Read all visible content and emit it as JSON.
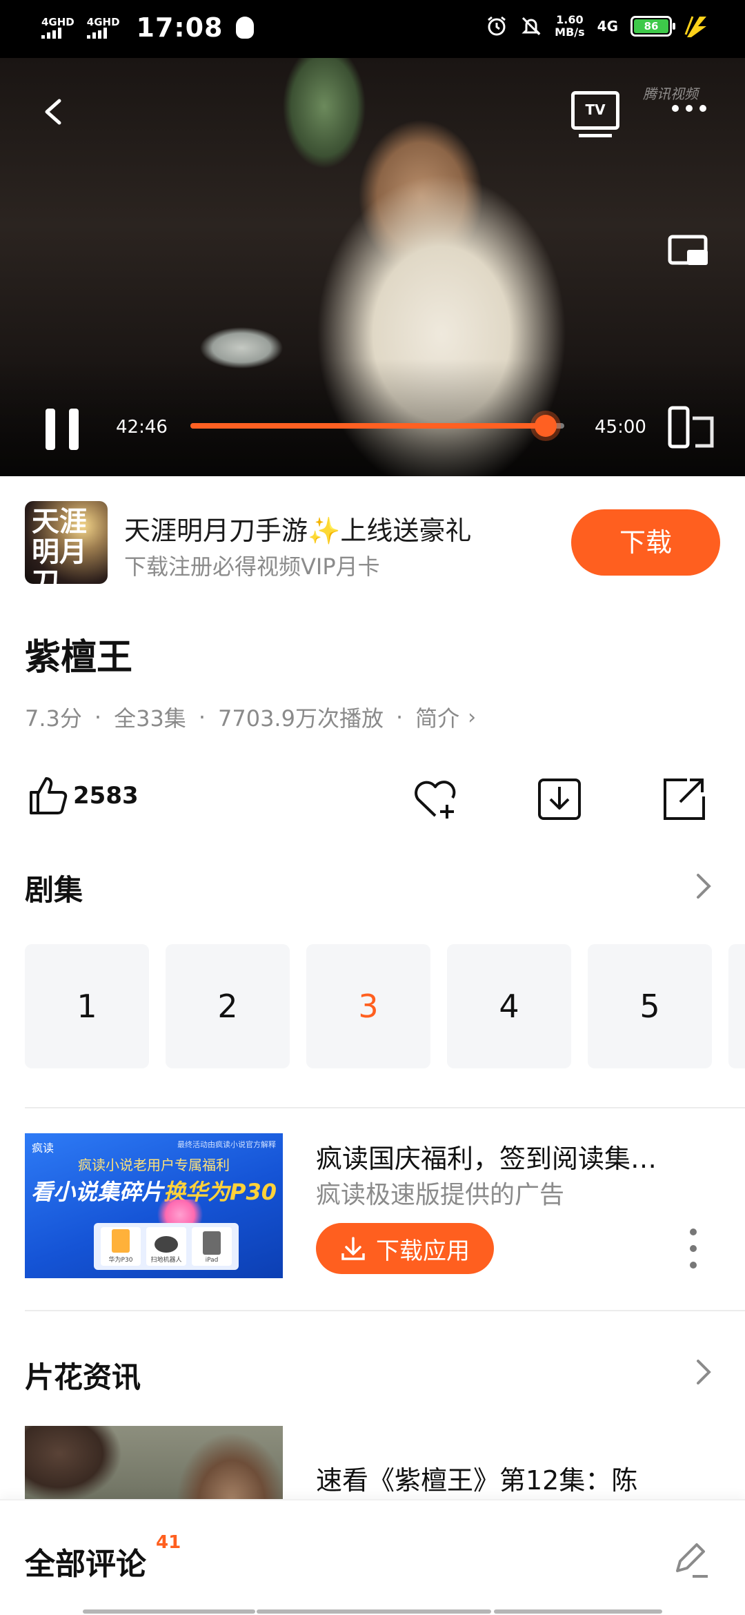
{
  "status_bar": {
    "sim1": "4GHD",
    "sim2": "4GHD",
    "time": "17:08",
    "net_speed_value": "1.60",
    "net_speed_unit": "MB/s",
    "network": "4G",
    "battery": "86",
    "icons": [
      "qq-icon",
      "alarm-icon",
      "mute-icon",
      "charging-bolt-icon"
    ]
  },
  "player": {
    "watermark": "腾讯视频",
    "tv_label": "TV",
    "elapsed": "42:46",
    "duration": "45:00",
    "progress_fraction": 0.95,
    "state": "playing",
    "accent": "#ff6022"
  },
  "ad_banner": {
    "logo_text": "天涯明月刀",
    "title": "天涯明月刀手游✨上线送豪礼",
    "subtitle": "下载注册必得视频VIP月卡",
    "button": "下载"
  },
  "show": {
    "title": "紫檀王",
    "score": "7.3分",
    "episodes_total": "全33集",
    "plays": "7703.9万次播放",
    "intro_link": "简介"
  },
  "actions": {
    "like_count": "2583",
    "icons": [
      "thumb-up-icon",
      "favorite-add-icon",
      "download-icon",
      "share-icon"
    ]
  },
  "episodes": {
    "header": "剧集",
    "items": [
      "1",
      "2",
      "3",
      "4",
      "5"
    ],
    "active_index": 2
  },
  "ad_card": {
    "image_brand": "疯读",
    "image_note": "最终活动由疯读小说官方解释",
    "image_line1": "疯读小说老用户专属福利",
    "image_line2a": "看小说集碎片",
    "image_line2b": "换华为P30",
    "prizes": [
      "华为P30",
      "扫地机器人",
      "iPad"
    ],
    "title": "疯读国庆福利，签到阅读集…",
    "subtitle": "疯读极速版提供的广告",
    "button": "下载应用"
  },
  "news": {
    "header": "片花资讯",
    "item_title": "速看《紫檀王》第12集：陈"
  },
  "comments": {
    "title": "全部评论",
    "count": "41"
  },
  "colors": {
    "accent": "#ff5f1f",
    "tile_bg": "#f5f6f8",
    "muted_text": "#8b8b8b"
  }
}
